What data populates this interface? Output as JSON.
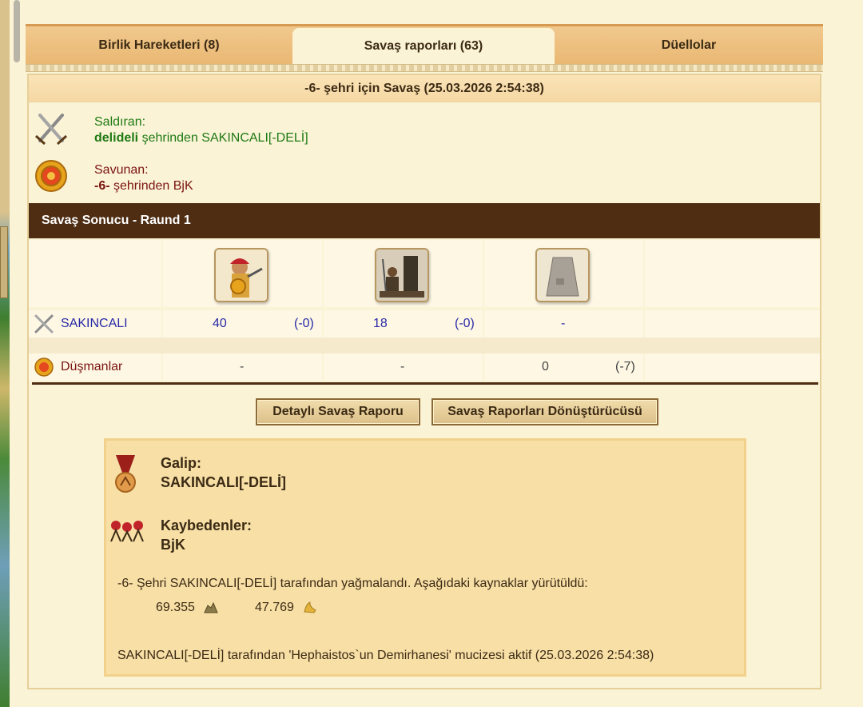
{
  "tabs": [
    {
      "label": "Birlik Hareketleri (8)"
    },
    {
      "label": "Savaş raporları (63)"
    },
    {
      "label": "Düellolar"
    }
  ],
  "report": {
    "title": "-6- şehri için Savaş (25.03.2026 2:54:38)"
  },
  "attacker": {
    "role": "Saldıran:",
    "city": "delideli",
    "connector": " şehrinden ",
    "player": "SAKINCALI[-DELİ]"
  },
  "defender": {
    "role": "Savunan:",
    "city": "-6-",
    "connector": " şehrinden ",
    "player": "BjK"
  },
  "round": {
    "title": "Savaş Sonucu - Raund 1"
  },
  "units": {
    "attacker_label": "SAKINCALI",
    "enemy_label": "Düşmanlar",
    "attacker_values": [
      "40",
      "(-0)",
      "18",
      "(-0)",
      "-"
    ],
    "enemy_values": [
      "-",
      "-",
      "0",
      "(-7)"
    ]
  },
  "buttons": {
    "detailed": "Detaylı Savaş Raporu",
    "converter": "Savaş Raporları Dönüştürücüsü"
  },
  "result": {
    "winner_label": "Galip:",
    "winner": "SAKINCALI[-DELİ]",
    "losers_label": "Kaybedenler:",
    "losers": "BjK",
    "plunder_text": "-6- Şehri SAKINCALI[-DELİ] tarafından yağmalandı. Aşağıdaki kaynaklar yürütüldü:",
    "resource1": "69.355",
    "resource2": "47.769",
    "wonder_text": "SAKINCALI[-DELİ] tarafından 'Hephaistos`un Demirhanesi' mucizesi aktif (25.03.2026 2:54:38)"
  },
  "colors": {
    "dark_bar": "#4e2d13",
    "attacker_text": "#1e7a14",
    "defender_text": "#7a1410",
    "unit_number": "#2a2aa8"
  }
}
